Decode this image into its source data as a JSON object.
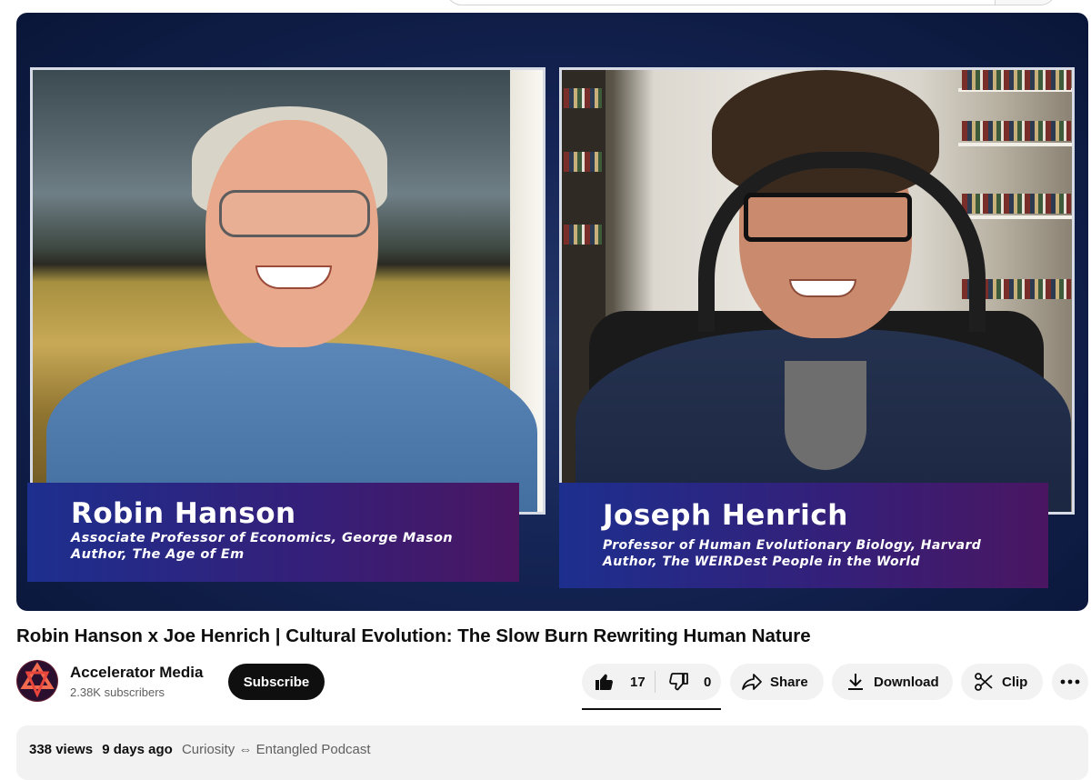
{
  "video": {
    "guest_left": {
      "name": "Robin Hanson",
      "line1": "Associate Professor of Economics, George Mason",
      "line2": "Author, The Age of Em"
    },
    "guest_right": {
      "name": "Joseph Henrich",
      "line1": "Professor of Human Evolutionary Biology, Harvard",
      "line2": "Author, The WEIRDest People in the World"
    }
  },
  "title": "Robin Hanson x Joe Henrich | Cultural Evolution: The Slow Burn Rewriting Human Nature",
  "channel": {
    "name": "Accelerator Media",
    "subscribers": "2.38K subscribers",
    "subscribe_label": "Subscribe"
  },
  "actions": {
    "likes": "17",
    "dislikes": "0",
    "share": "Share",
    "download": "Download",
    "clip": "Clip"
  },
  "description": {
    "views": "338 views",
    "age": "9 days ago",
    "tags": "Curiosity ⇔ Entangled Podcast"
  },
  "icons": [
    "search-icon",
    "thumbs-up-icon",
    "thumbs-down-icon",
    "share-icon",
    "download-icon",
    "scissors-icon",
    "more-icon"
  ],
  "colors": {
    "lower_third_start": "#1d2f8e",
    "lower_third_end": "#4a1662",
    "subscribe_bg": "#0f0f0f",
    "pill_bg": "#f2f2f2"
  }
}
